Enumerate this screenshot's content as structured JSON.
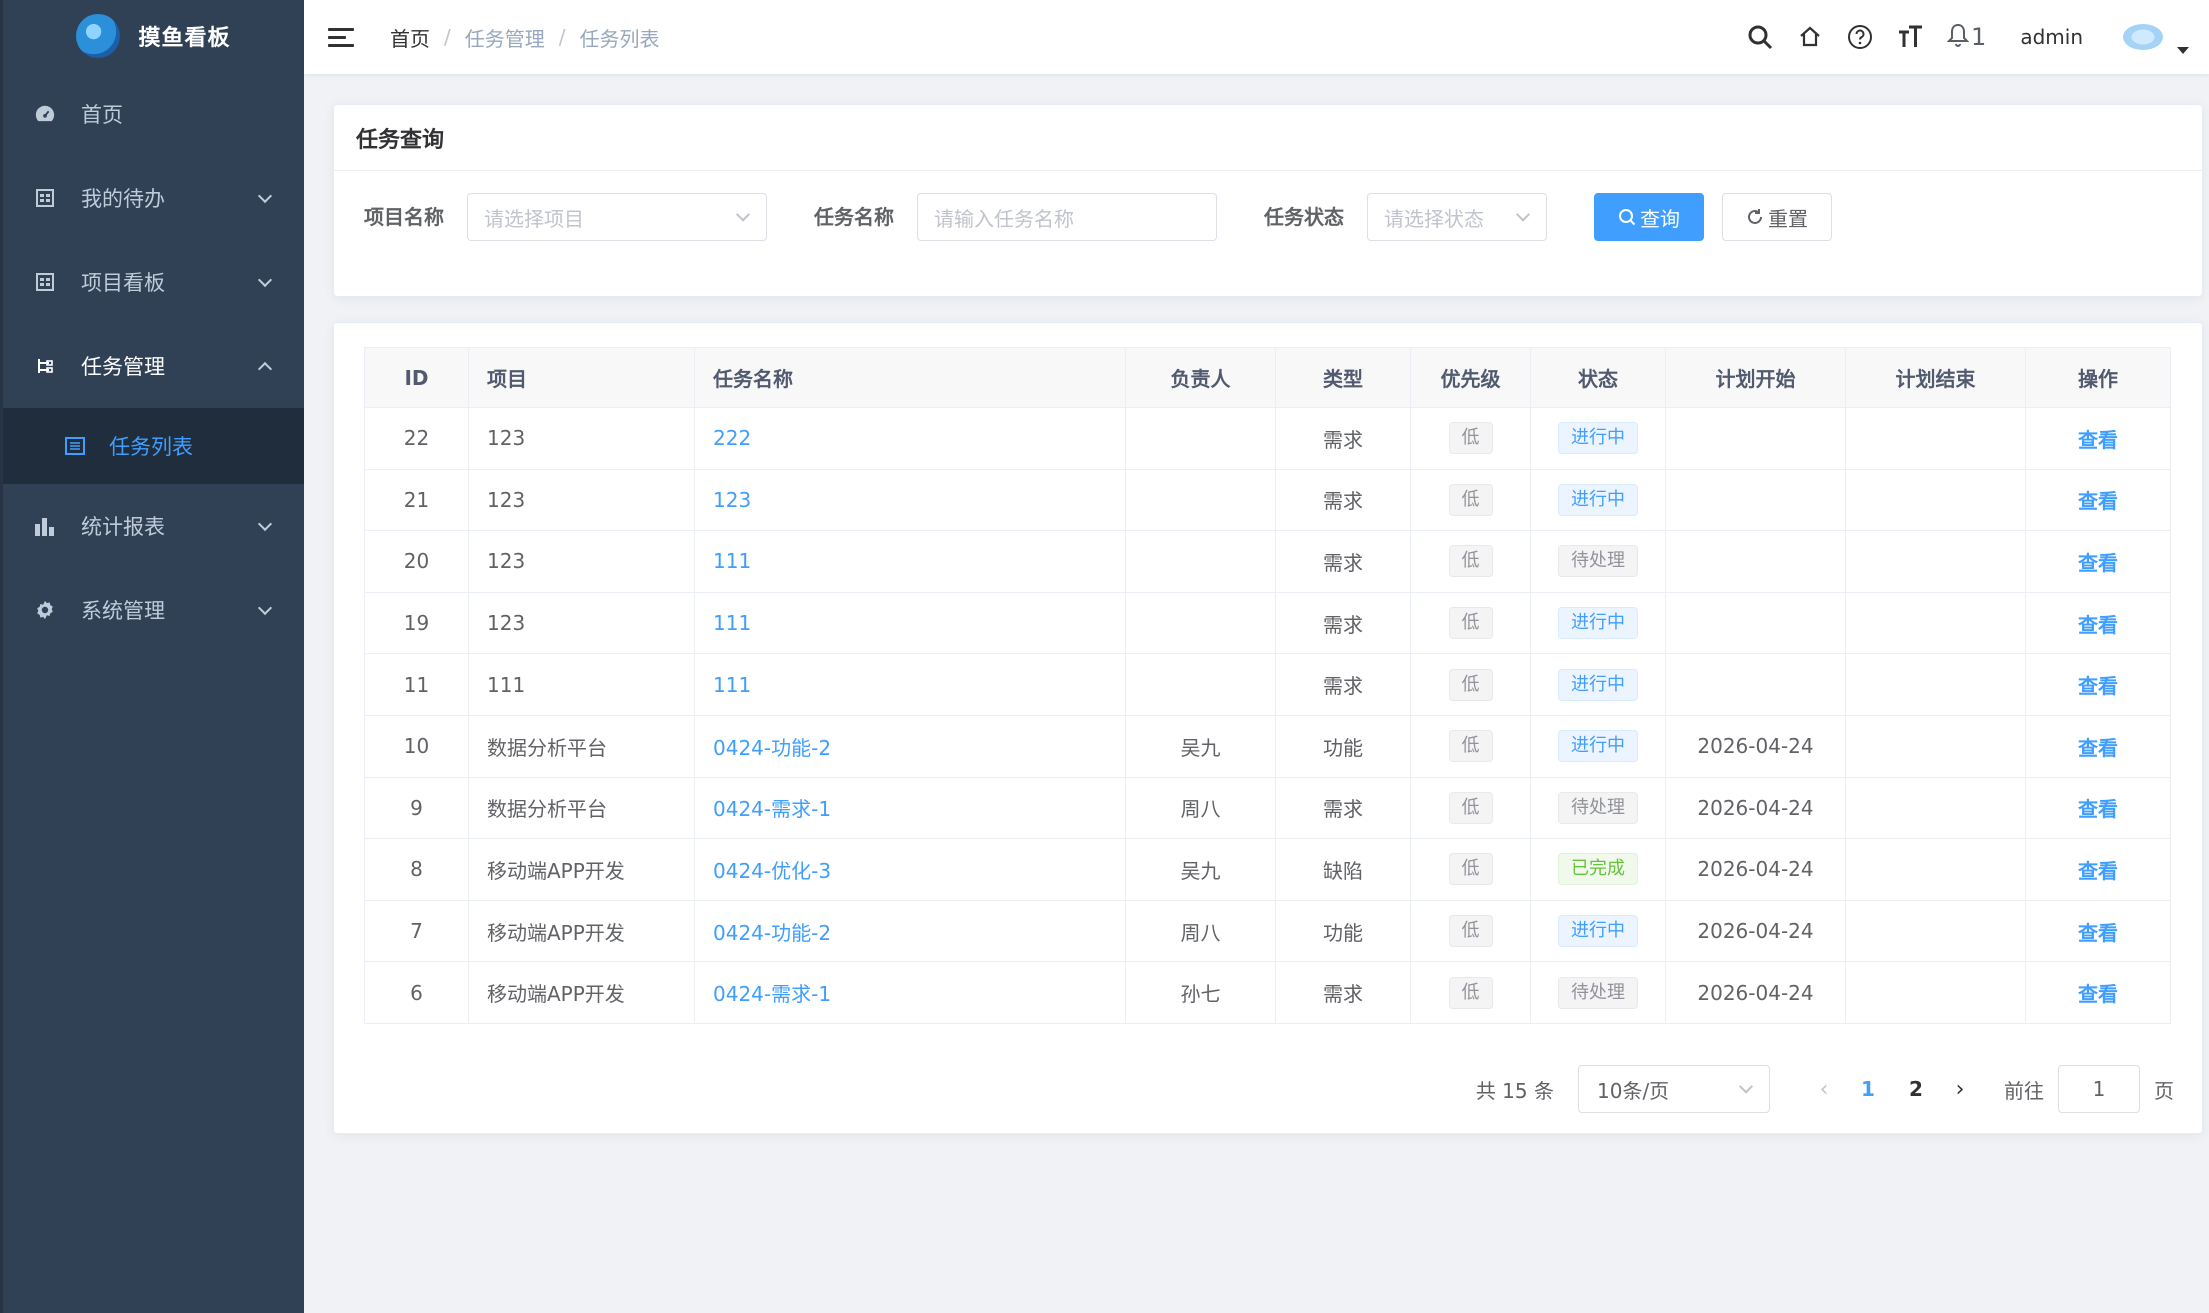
{
  "app": {
    "title": "摸鱼看板"
  },
  "sidebar": {
    "items": [
      {
        "label": "首页",
        "icon": "dashboard-icon"
      },
      {
        "label": "我的待办",
        "icon": "todo-icon"
      },
      {
        "label": "项目看板",
        "icon": "board-icon"
      },
      {
        "label": "任务管理",
        "icon": "tree-icon"
      },
      {
        "label": "统计报表",
        "icon": "bar-chart-icon"
      },
      {
        "label": "系统管理",
        "icon": "gear-icon"
      }
    ],
    "sub_item": {
      "label": "任务列表",
      "icon": "list-icon"
    }
  },
  "header": {
    "breadcrumb": [
      "首页",
      "任务管理",
      "任务列表"
    ],
    "notification_count": "1",
    "username": "admin"
  },
  "search": {
    "title": "任务查询",
    "project_label": "项目名称",
    "project_placeholder": "请选择项目",
    "task_label": "任务名称",
    "task_placeholder": "请输入任务名称",
    "status_label": "任务状态",
    "status_placeholder": "请选择状态",
    "query_button": "查询",
    "reset_button": "重置"
  },
  "table": {
    "headers": [
      "ID",
      "项目",
      "任务名称",
      "负责人",
      "类型",
      "优先级",
      "状态",
      "计划开始",
      "计划结束",
      "操作"
    ],
    "rows": [
      {
        "id": "22",
        "project": "123",
        "name": "222",
        "owner": "",
        "type": "需求",
        "priority": "低",
        "status": "进行中",
        "status_kind": "doing",
        "start": "",
        "end": "",
        "op": "查看"
      },
      {
        "id": "21",
        "project": "123",
        "name": "123",
        "owner": "",
        "type": "需求",
        "priority": "低",
        "status": "进行中",
        "status_kind": "doing",
        "start": "",
        "end": "",
        "op": "查看"
      },
      {
        "id": "20",
        "project": "123",
        "name": "111",
        "owner": "",
        "type": "需求",
        "priority": "低",
        "status": "待处理",
        "status_kind": "todo",
        "start": "",
        "end": "",
        "op": "查看"
      },
      {
        "id": "19",
        "project": "123",
        "name": "111",
        "owner": "",
        "type": "需求",
        "priority": "低",
        "status": "进行中",
        "status_kind": "doing",
        "start": "",
        "end": "",
        "op": "查看"
      },
      {
        "id": "11",
        "project": "111",
        "name": "111",
        "owner": "",
        "type": "需求",
        "priority": "低",
        "status": "进行中",
        "status_kind": "doing",
        "start": "",
        "end": "",
        "op": "查看"
      },
      {
        "id": "10",
        "project": "数据分析平台",
        "name": "0424-功能-2",
        "owner": "吴九",
        "type": "功能",
        "priority": "低",
        "status": "进行中",
        "status_kind": "doing",
        "start": "2026-04-24",
        "end": "",
        "op": "查看"
      },
      {
        "id": "9",
        "project": "数据分析平台",
        "name": "0424-需求-1",
        "owner": "周八",
        "type": "需求",
        "priority": "低",
        "status": "待处理",
        "status_kind": "todo",
        "start": "2026-04-24",
        "end": "",
        "op": "查看"
      },
      {
        "id": "8",
        "project": "移动端APP开发",
        "name": "0424-优化-3",
        "owner": "吴九",
        "type": "缺陷",
        "priority": "低",
        "status": "已完成",
        "status_kind": "done",
        "start": "2026-04-24",
        "end": "",
        "op": "查看"
      },
      {
        "id": "7",
        "project": "移动端APP开发",
        "name": "0424-功能-2",
        "owner": "周八",
        "type": "功能",
        "priority": "低",
        "status": "进行中",
        "status_kind": "doing",
        "start": "2026-04-24",
        "end": "",
        "op": "查看"
      },
      {
        "id": "6",
        "project": "移动端APP开发",
        "name": "0424-需求-1",
        "owner": "孙七",
        "type": "需求",
        "priority": "低",
        "status": "待处理",
        "status_kind": "todo",
        "start": "2026-04-24",
        "end": "",
        "op": "查看"
      }
    ]
  },
  "pagination": {
    "total": "共 15 条",
    "page_size": "10条/页",
    "pages": [
      "1",
      "2"
    ],
    "current": "1",
    "goto_label": "前往",
    "goto_value": "1",
    "page_suffix": "页"
  },
  "colors": {
    "primary": "#409eff",
    "sidebar": "#304156",
    "success": "#67c23a"
  }
}
